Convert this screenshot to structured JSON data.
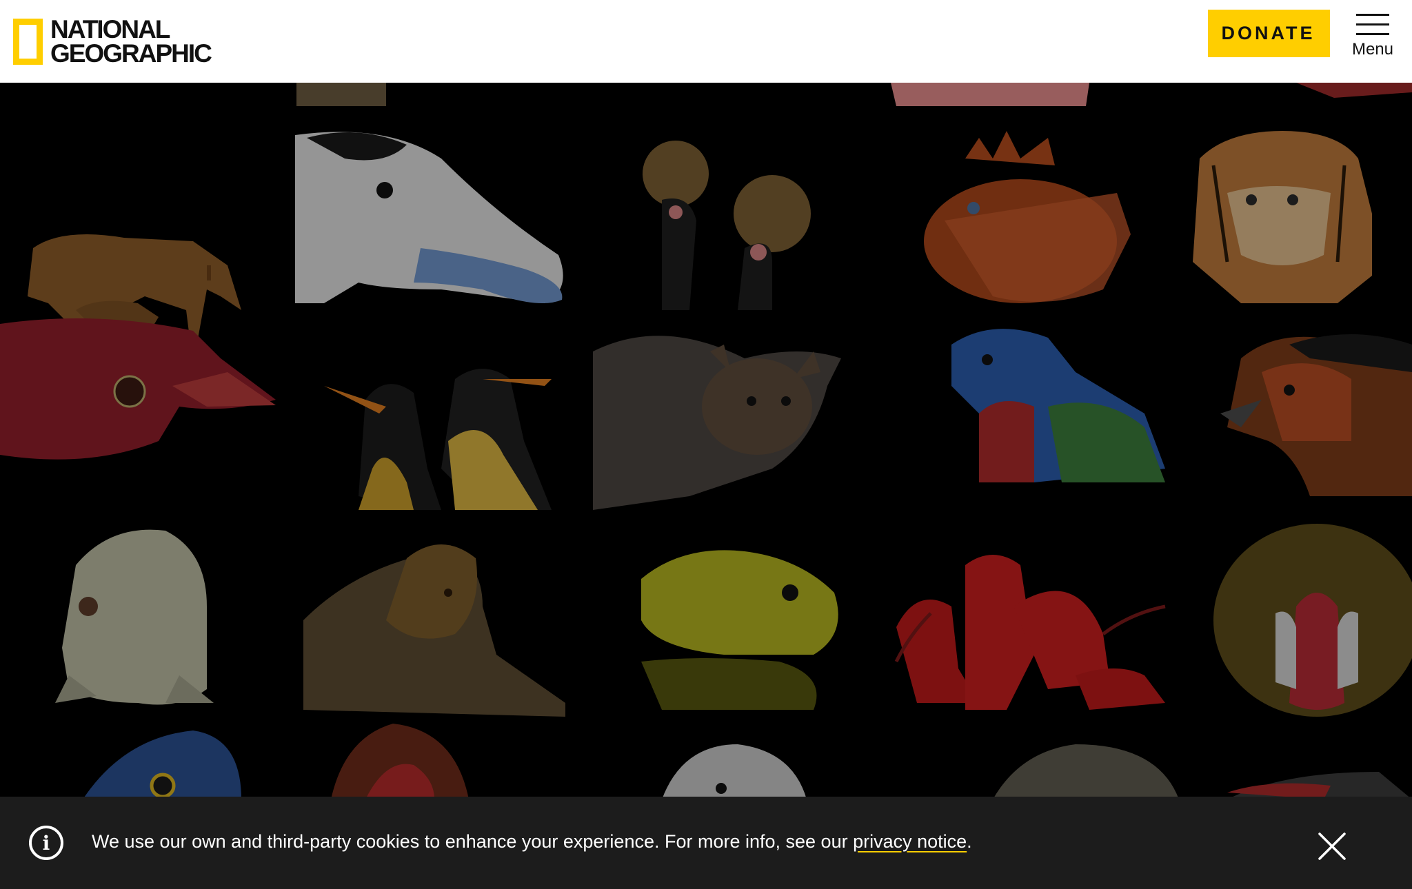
{
  "header": {
    "logo_line1": "NATIONAL",
    "logo_line2": "GEOGRAPHIC",
    "donate_label": "DONATE",
    "menu_label": "Menu"
  },
  "colors": {
    "brand_yellow": "#FFCE00",
    "header_bg": "#FFFFFF",
    "gallery_bg": "#000000",
    "banner_bg": "#1C1C1C"
  },
  "gallery": {
    "tiles": [
      {
        "name": "muntjac-deer-tile",
        "icon": "deer"
      },
      {
        "name": "steamer-duck-tile",
        "icon": "duck"
      },
      {
        "name": "crowned-crane-tile",
        "icon": "crane"
      },
      {
        "name": "lionfish-tile",
        "icon": "lionfish"
      },
      {
        "name": "tiger-tile",
        "icon": "tiger"
      },
      {
        "name": "red-finch-tile",
        "icon": "finch"
      },
      {
        "name": "king-penguin-tile",
        "icon": "penguin"
      },
      {
        "name": "fruit-bat-tile",
        "icon": "bat"
      },
      {
        "name": "parrot-finch-tile",
        "icon": "parrot"
      },
      {
        "name": "orange-bird-tile",
        "icon": "bird"
      },
      {
        "name": "white-frog-tile",
        "icon": "frog"
      },
      {
        "name": "lion-tile",
        "icon": "lion"
      },
      {
        "name": "yellow-frog-tile",
        "icon": "frog"
      },
      {
        "name": "scarlet-ibis-tile",
        "icon": "ibis"
      },
      {
        "name": "mandrill-tile",
        "icon": "mandrill"
      },
      {
        "name": "blue-macaw-tile",
        "icon": "macaw"
      },
      {
        "name": "uakari-tile",
        "icon": "monkey"
      },
      {
        "name": "white-eagle-tile",
        "icon": "eagle"
      },
      {
        "name": "mammal-tile",
        "icon": "mammal"
      },
      {
        "name": "red-bill-bird-tile",
        "icon": "bird"
      }
    ]
  },
  "cookie_banner": {
    "message": "We use our own and third-party cookies to enhance your experience. For more info, see our ",
    "link_label": "privacy notice",
    "suffix": "."
  }
}
